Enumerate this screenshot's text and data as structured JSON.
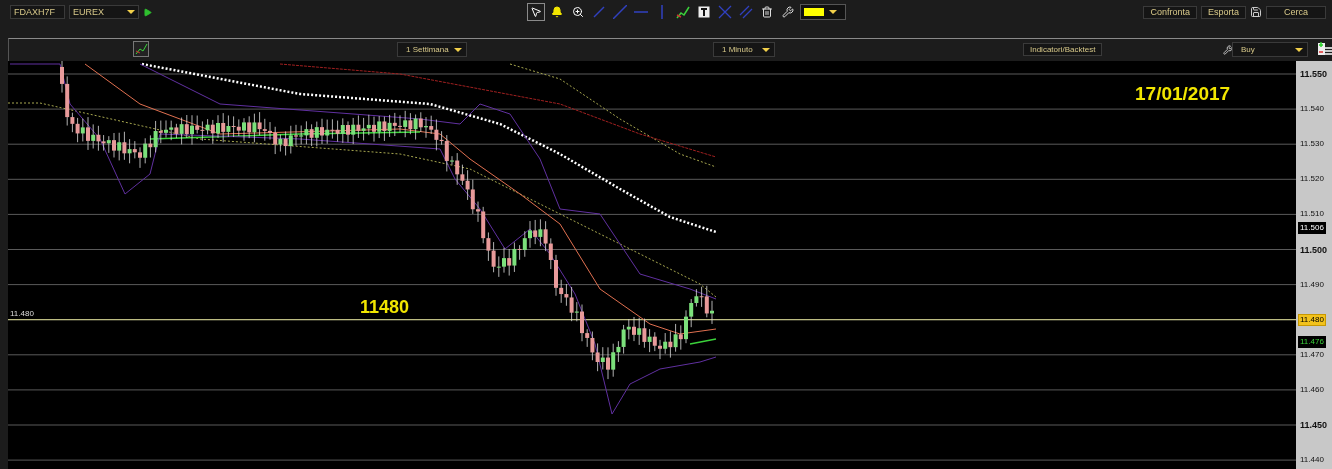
{
  "toolbar": {
    "symbol": "FDAXH7F",
    "exchange": "EUREX",
    "tools": [
      {
        "kind": "pointer",
        "selected": true
      },
      {
        "kind": "alert",
        "selected": false
      },
      {
        "kind": "zoom",
        "selected": false
      },
      {
        "kind": "segment",
        "selected": false
      },
      {
        "kind": "line",
        "selected": false
      },
      {
        "kind": "hline",
        "selected": false
      },
      {
        "kind": "vline",
        "selected": false
      },
      {
        "kind": "study",
        "selected": false
      },
      {
        "kind": "text",
        "selected": false
      },
      {
        "kind": "cross",
        "selected": false
      },
      {
        "kind": "parallel",
        "selected": false
      },
      {
        "kind": "trash",
        "selected": false
      },
      {
        "kind": "tools",
        "selected": false
      }
    ],
    "buttons": [
      "Confronta",
      "Esporta",
      "Cerca"
    ]
  },
  "chart_bar": {
    "period": "1 Settimana",
    "interval": "1 Minuto",
    "indicators_button": "Indicatori/Backtest",
    "order_type": "Buy"
  },
  "chart": {
    "date_note": "17/01/2017",
    "level_note": "11480",
    "price_line_label": "11.480",
    "axis_labels": [
      {
        "text": "11.550",
        "major": true
      },
      {
        "text": "11.540",
        "major": false
      },
      {
        "text": "11.530",
        "major": false
      },
      {
        "text": "11.520",
        "major": false
      },
      {
        "text": "11.510",
        "major": false
      },
      {
        "text": "11.500",
        "major": true
      },
      {
        "text": "11.490",
        "major": false
      },
      {
        "text": "11.470",
        "major": false
      },
      {
        "text": "11.460",
        "major": false
      },
      {
        "text": "11.450",
        "major": true
      },
      {
        "text": "11.440",
        "major": false
      }
    ],
    "price_badges": [
      {
        "text": "11.506",
        "kind": "average"
      },
      {
        "text": "11.480",
        "kind": "line"
      },
      {
        "text": "11.476",
        "kind": "last"
      }
    ]
  }
}
